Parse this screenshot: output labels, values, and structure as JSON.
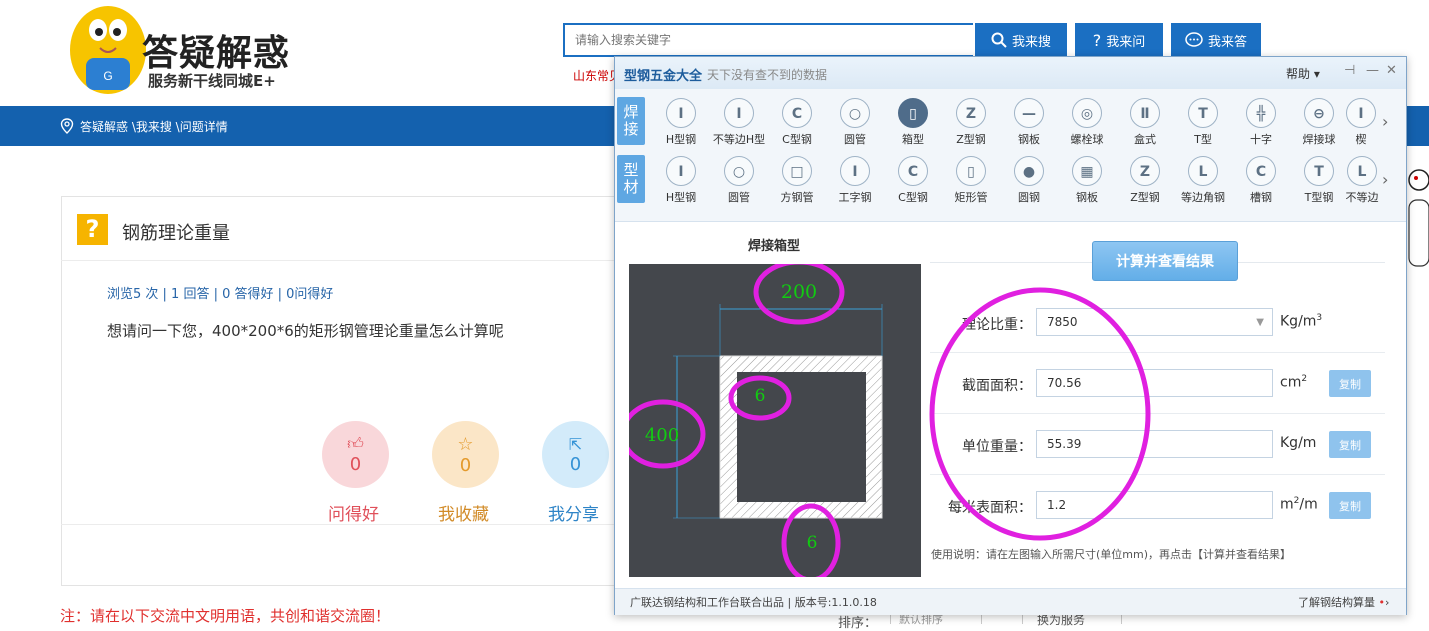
{
  "header": {
    "logo_title": "答疑解惑",
    "logo_subtitle": "服务新干线同城E+",
    "search_placeholder": "请输入搜索关键字",
    "btn_search": "我来搜",
    "btn_ask": "我来问",
    "btn_answer": "我来答",
    "hot_link": "山东常见",
    "colors": {
      "primary": "#1b6fc2",
      "nav": "#1461ae"
    }
  },
  "breadcrumb": {
    "text": "答疑解惑 \\我来搜 \\问题详情"
  },
  "question": {
    "title": "钢筋理论重量",
    "stats": "浏览5 次 | 1 回答 | 0 答得好 | 0问得好",
    "body": "想请问一下您，400*200*6的矩形钢管理论重量怎么计算呢",
    "actions": [
      {
        "label": "问得好",
        "count": "0"
      },
      {
        "label": "我收藏",
        "count": "0"
      },
      {
        "label": "我分享",
        "count": "0"
      }
    ],
    "notice": "注：请在以下交流中文明用语，共创和谐交流圈！"
  },
  "bottom": {
    "sort_label": "排序：",
    "sort_value": "默认排序",
    "switch_label": "换为服务"
  },
  "modal": {
    "title": "型钢五金大全",
    "slogan": "天下没有查不到的数据",
    "help": "帮助",
    "weld_tag": [
      "焊",
      "接"
    ],
    "profile_tag": [
      "型",
      "材"
    ],
    "weld_items": [
      "H型钢",
      "不等边H型",
      "C型钢",
      "圆管",
      "箱型",
      "Z型钢",
      "钢板",
      "螺栓球",
      "盒式",
      "T型",
      "十字",
      "焊接球",
      "楔"
    ],
    "profile_items": [
      "H型钢",
      "圆管",
      "方钢管",
      "工字钢",
      "C型钢",
      "矩形管",
      "圆钢",
      "钢板",
      "Z型钢",
      "等边角钢",
      "槽钢",
      "T型钢",
      "不等边"
    ],
    "selected_weld": "箱型",
    "drawing_title": "焊接箱型",
    "dims": {
      "width": "200",
      "height": "400",
      "web": "6",
      "flange": "6"
    },
    "calc_button": "计算并查看结果",
    "fields": [
      {
        "label": "理论比重：",
        "value": "7850",
        "unit": "Kg/m",
        "sup": "3",
        "copy": ""
      },
      {
        "label": "截面面积：",
        "value": "70.56",
        "unit": "cm",
        "sup": "2",
        "copy": "复制"
      },
      {
        "label": "单位重量：",
        "value": "55.39",
        "unit": "Kg/m",
        "sup": "",
        "copy": "复制"
      },
      {
        "label": "每米表面积：",
        "value": "1.2",
        "unit": "m",
        "sup": "2",
        "unit_tail": "/m",
        "copy": "复制"
      }
    ],
    "usage": "使用说明：请在左图输入所需尺寸(单位mm)，再点击【计算并查看结果】",
    "footer_left": "广联达钢结构和工作台联合出品  |  版本号:1.1.0.18",
    "footer_right": "了解钢结构算量"
  }
}
